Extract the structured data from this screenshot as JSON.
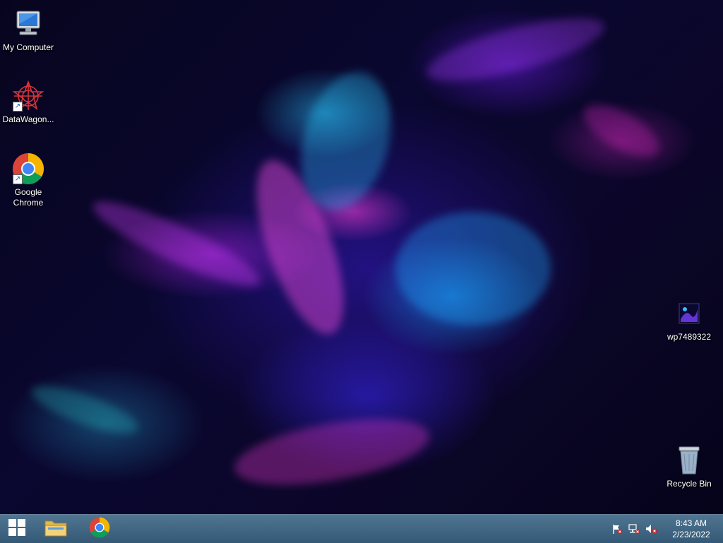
{
  "desktop": {
    "icons": [
      {
        "label": "My Computer",
        "icon": "computer-icon"
      },
      {
        "label": "DataWagon...",
        "icon": "datawagon-icon"
      },
      {
        "label": "Google Chrome",
        "icon": "chrome-icon"
      },
      {
        "label": "wp7489322",
        "icon": "image-file-icon"
      },
      {
        "label": "Recycle Bin",
        "icon": "recycle-bin-icon"
      }
    ]
  },
  "taskbar": {
    "start_icon": "windows-logo-icon",
    "pinned": [
      {
        "name": "File Explorer",
        "icon": "folder-icon"
      },
      {
        "name": "Google Chrome",
        "icon": "chrome-icon"
      }
    ],
    "tray": {
      "icons": [
        "action-center-flag-icon",
        "network-icon",
        "volume-muted-icon"
      ],
      "time": "8:43 AM",
      "date": "2/23/2022"
    },
    "colors": {
      "taskbar": "#3f6f90"
    }
  }
}
